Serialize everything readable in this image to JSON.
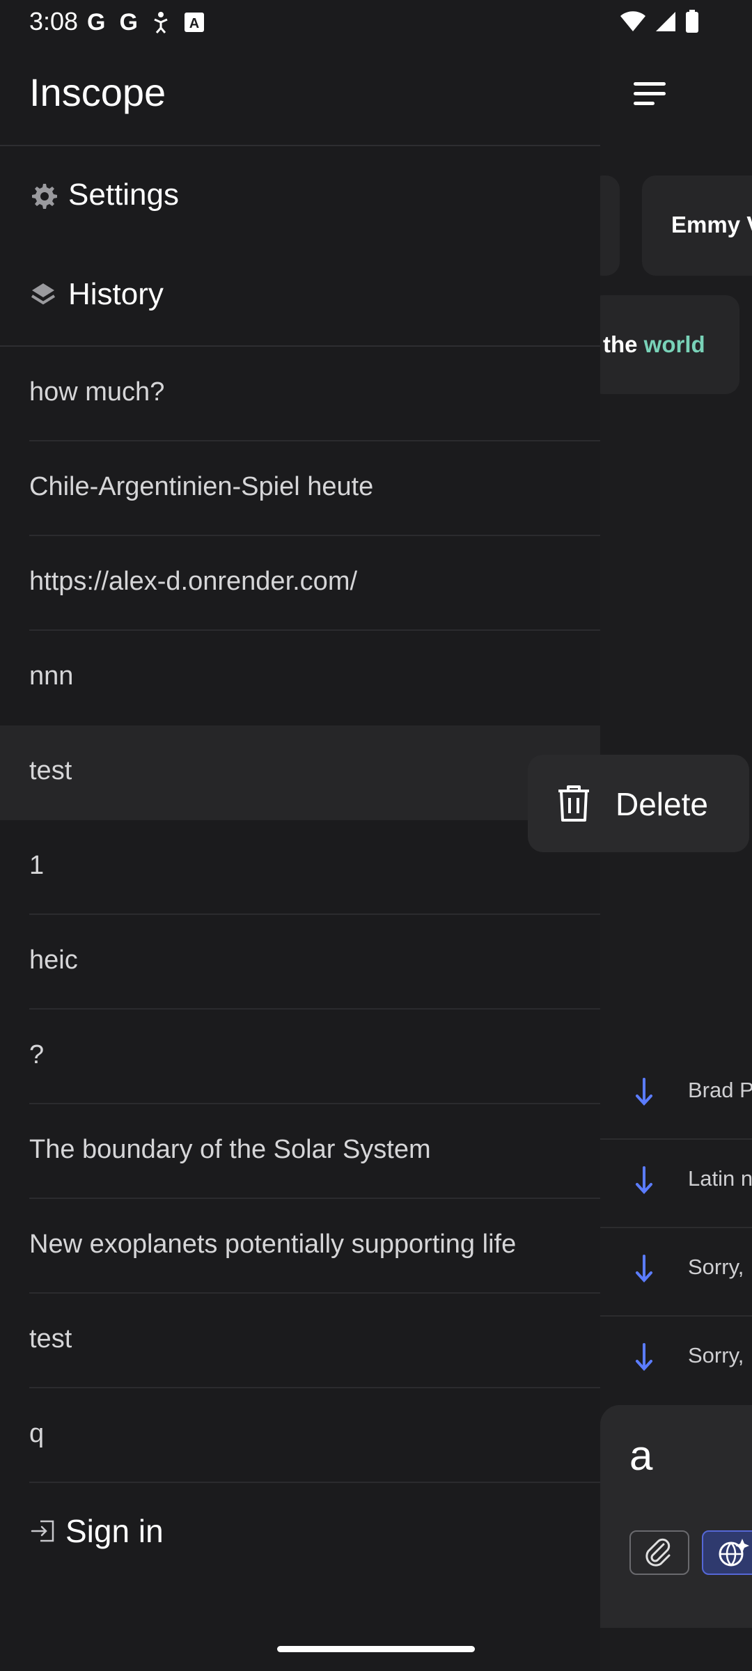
{
  "status_bar": {
    "time": "3:08",
    "left_icons": [
      "google-icon",
      "google-icon",
      "accessibility-icon",
      "keyboard-icon"
    ],
    "right_icons": [
      "wifi-icon",
      "signal-icon",
      "battery-icon"
    ]
  },
  "drawer": {
    "title": "Inscope",
    "settings_label": "Settings",
    "history_label": "History",
    "history_items": [
      "how much?",
      "Chile-Argentinien-Spiel heute",
      "https://alex-d.onrender.com/",
      "nnn",
      "test",
      "1",
      "heic",
      "?",
      "The boundary of the Solar System",
      "New exoplanets potentially supporting life",
      "test",
      "q"
    ],
    "selected_index": 4,
    "sign_in_label": "Sign in"
  },
  "context_menu": {
    "delete_label": "Delete"
  },
  "background": {
    "card_1_text": "Emmy V",
    "card_2_text_plain": "the",
    "card_2_text_accent": "world",
    "results": [
      "Brad P",
      "Latin n",
      "Sorry,",
      "Sorry,"
    ],
    "input_value": "a"
  },
  "colors": {
    "accent_green": "#79d2b8",
    "accent_blue": "#5567d6"
  }
}
